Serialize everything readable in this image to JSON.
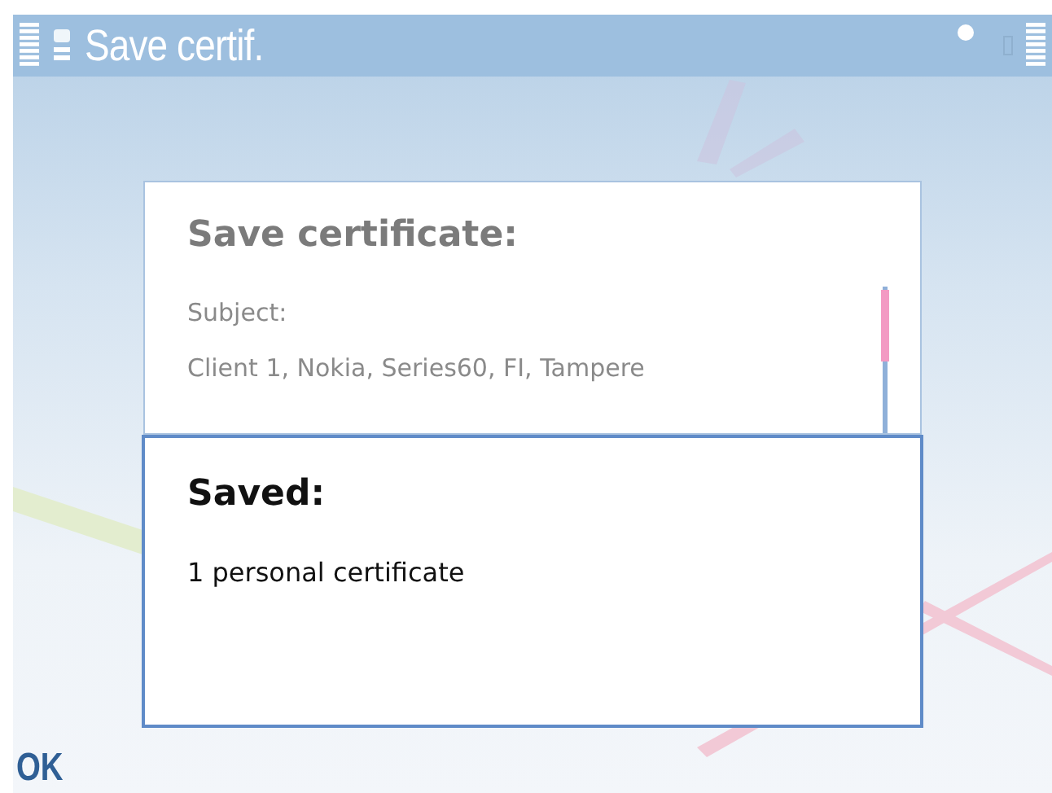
{
  "title_bar": {
    "title": "Save certif."
  },
  "background_dialog": {
    "heading": "Save certificate:",
    "lines": [
      "Subject:",
      "Client 1, Nokia, Series60, FI, Tampere"
    ]
  },
  "note": {
    "heading": "Saved:",
    "message": "1 personal certificate"
  },
  "softkeys": {
    "left": "OK"
  }
}
